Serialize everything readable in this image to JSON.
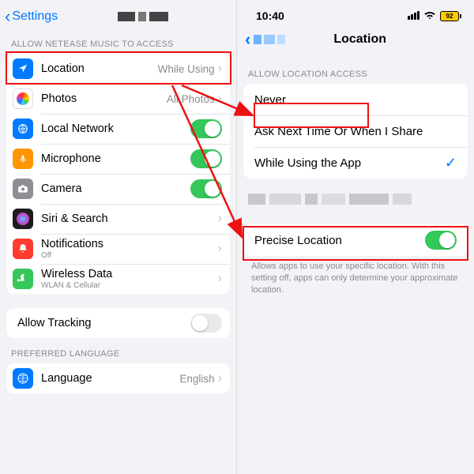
{
  "left": {
    "back": "Settings",
    "section1_head": "ALLOW NETEASE MUSIC TO ACCESS",
    "rows": {
      "location": {
        "label": "Location",
        "value": "While Using"
      },
      "photos": {
        "label": "Photos",
        "value": "All Photos"
      },
      "localnet": {
        "label": "Local Network"
      },
      "mic": {
        "label": "Microphone"
      },
      "camera": {
        "label": "Camera"
      },
      "siri": {
        "label": "Siri & Search"
      },
      "notif": {
        "label": "Notifications",
        "sub": "Off"
      },
      "wireless": {
        "label": "Wireless Data",
        "sub": "WLAN & Cellular"
      }
    },
    "tracking": {
      "label": "Allow Tracking"
    },
    "section2_head": "PREFERRED LANGUAGE",
    "language": {
      "label": "Language",
      "value": "English"
    }
  },
  "right": {
    "time": "10:40",
    "battery": "92",
    "title": "Location",
    "section_head": "ALLOW LOCATION ACCESS",
    "options": {
      "never": "Never",
      "ask": "Ask Next Time Or When I Share",
      "while": "While Using the App"
    },
    "precise": {
      "label": "Precise Location"
    },
    "footer": "Allows apps to use your specific location. With this setting off, apps can only determine your approximate location."
  }
}
